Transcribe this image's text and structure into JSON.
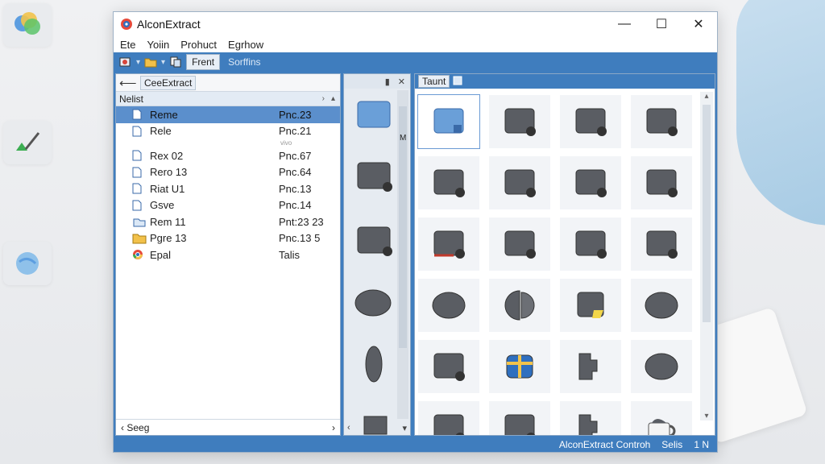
{
  "window": {
    "title": "AlconExtract",
    "controls": {
      "minimize": "—",
      "maximize": "☐",
      "close": "✕"
    }
  },
  "menu": [
    "Ete",
    "Yoiin",
    "Prohuct",
    "Egrhow"
  ],
  "toolbar": {
    "tabs": [
      {
        "label": "Frent",
        "active": true
      },
      {
        "label": "Sorffins",
        "active": false
      }
    ]
  },
  "left_pane": {
    "path": "CeeExtract",
    "column_header": "Nelist",
    "files": [
      {
        "name": "Reme",
        "value": "Pnc.23",
        "icon": "file-icon",
        "selected": true
      },
      {
        "name": "Rele",
        "value": "Pnc.21",
        "icon": "file-icon",
        "sub": "vivo"
      },
      {
        "name": "Rex 02",
        "value": "Pnc.67",
        "icon": "file-icon"
      },
      {
        "name": "Rero 13",
        "value": "Pnc.64",
        "icon": "file-icon"
      },
      {
        "name": "Riat U1",
        "value": "Pnc.13",
        "icon": "file-icon"
      },
      {
        "name": "Gsve",
        "value": "Pnc.14",
        "icon": "file-icon"
      },
      {
        "name": "Rem 11",
        "value": "Pnt:23 23",
        "icon": "cloud-folder-icon"
      },
      {
        "name": "Pgre 13",
        "value": "Pnc.13 5",
        "icon": "folder-icon"
      },
      {
        "name": "Epal",
        "value": "Talis",
        "icon": "browser-icon"
      }
    ],
    "footer": "Seeg"
  },
  "middle_pane": {
    "header_icons": [
      "pin-icon",
      "close-icon"
    ],
    "scroll_marker": "M"
  },
  "right_pane": {
    "header_tab": "Taunt",
    "tiles": [
      "square-blue",
      "square",
      "square",
      "square",
      "square",
      "square",
      "square",
      "square",
      "square-red",
      "square",
      "square",
      "square",
      "disc",
      "disc-split",
      "square-yellow",
      "disc",
      "square",
      "cube",
      "puzzle",
      "disc",
      "square",
      "square",
      "puzzle",
      "mug"
    ]
  },
  "status": {
    "text": "AlconExtract Controh",
    "extra": "Selis",
    "page": "1 N"
  },
  "colors": {
    "accent": "#3f7dbe",
    "selection": "#5b8fcc",
    "tile_dark": "#5a5d63"
  }
}
